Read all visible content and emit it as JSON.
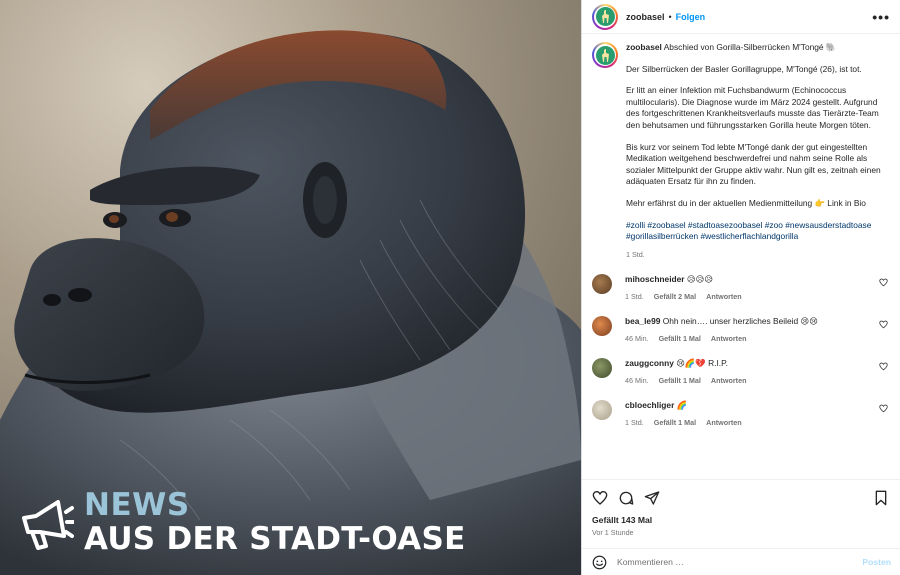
{
  "post": {
    "username": "zoobasel",
    "separator": "•",
    "follow_label": "Folgen",
    "more_label": "•••",
    "image_alt": "Porträt von Gorilla-Silberrücken M'Tongé",
    "overlay": {
      "line1": "NEWS",
      "line2": "AUS DER STADT-OASE",
      "megaphone_icon": "megaphone-icon"
    }
  },
  "caption": {
    "username": "zoobasel",
    "title": "Abschied von Gorilla-Silberrücken M'Tongé 🐘",
    "p1": "Der Silberrücken der Basler Gorillagruppe, M'Tongé (26), ist tot.",
    "p2": "Er litt an einer Infektion mit Fuchsbandwurm (Echinococcus multilocularis). Die Diagnose wurde im März 2024 gestellt. Aufgrund des fortgeschrittenen Krankheitsverlaufs musste das Tierärzte-Team den behutsamen und führungsstarken Gorilla heute Morgen töten.",
    "p3": "Bis kurz vor seinem Tod lebte M'Tongé dank der gut eingestellten Medikation weitgehend beschwerdefrei und nahm seine Rolle als sozialer Mittelpunkt der Gruppe aktiv wahr. Nun gilt es, zeitnah einen adäquaten Ersatz für ihn zu finden.",
    "p4": "Mehr erfährst du in der aktuellen Medienmitteilung 👉 Link in Bio",
    "hashtags": "#zolli #zoobasel #stadtoasezoobasel #zoo #newsausderstadtoase #gorillasilberrücken #westlicherflachlandgorilla",
    "time": "1 Std."
  },
  "comments": [
    {
      "username": "mihoschneider",
      "text": "😥😥😥",
      "time": "1 Std.",
      "likes": "Gefällt 2 Mal",
      "reply": "Antworten",
      "avatar_color": "#6b4b2e"
    },
    {
      "username": "bea_le99",
      "text": "Ohh nein…. unser herzliches Beileid 😢😢",
      "time": "46 Min.",
      "likes": "Gefällt 1 Mal",
      "reply": "Antworten",
      "avatar_color": "#b5562f"
    },
    {
      "username": "zauggconny",
      "text": "😢🌈💔 R.I.P.",
      "time": "46 Min.",
      "likes": "Gefällt 1 Mal",
      "reply": "Antworten",
      "avatar_color": "#5f6b44"
    },
    {
      "username": "cbloechliger",
      "text": "🌈",
      "time": "1 Std.",
      "likes": "Gefällt 1 Mal",
      "reply": "Antworten",
      "avatar_color": "#c9bfae"
    }
  ],
  "actions": {
    "likes": "Gefällt 143 Mal",
    "ago": "Vor 1 Stunde",
    "comment_placeholder": "Kommentieren …",
    "post_label": "Posten"
  }
}
